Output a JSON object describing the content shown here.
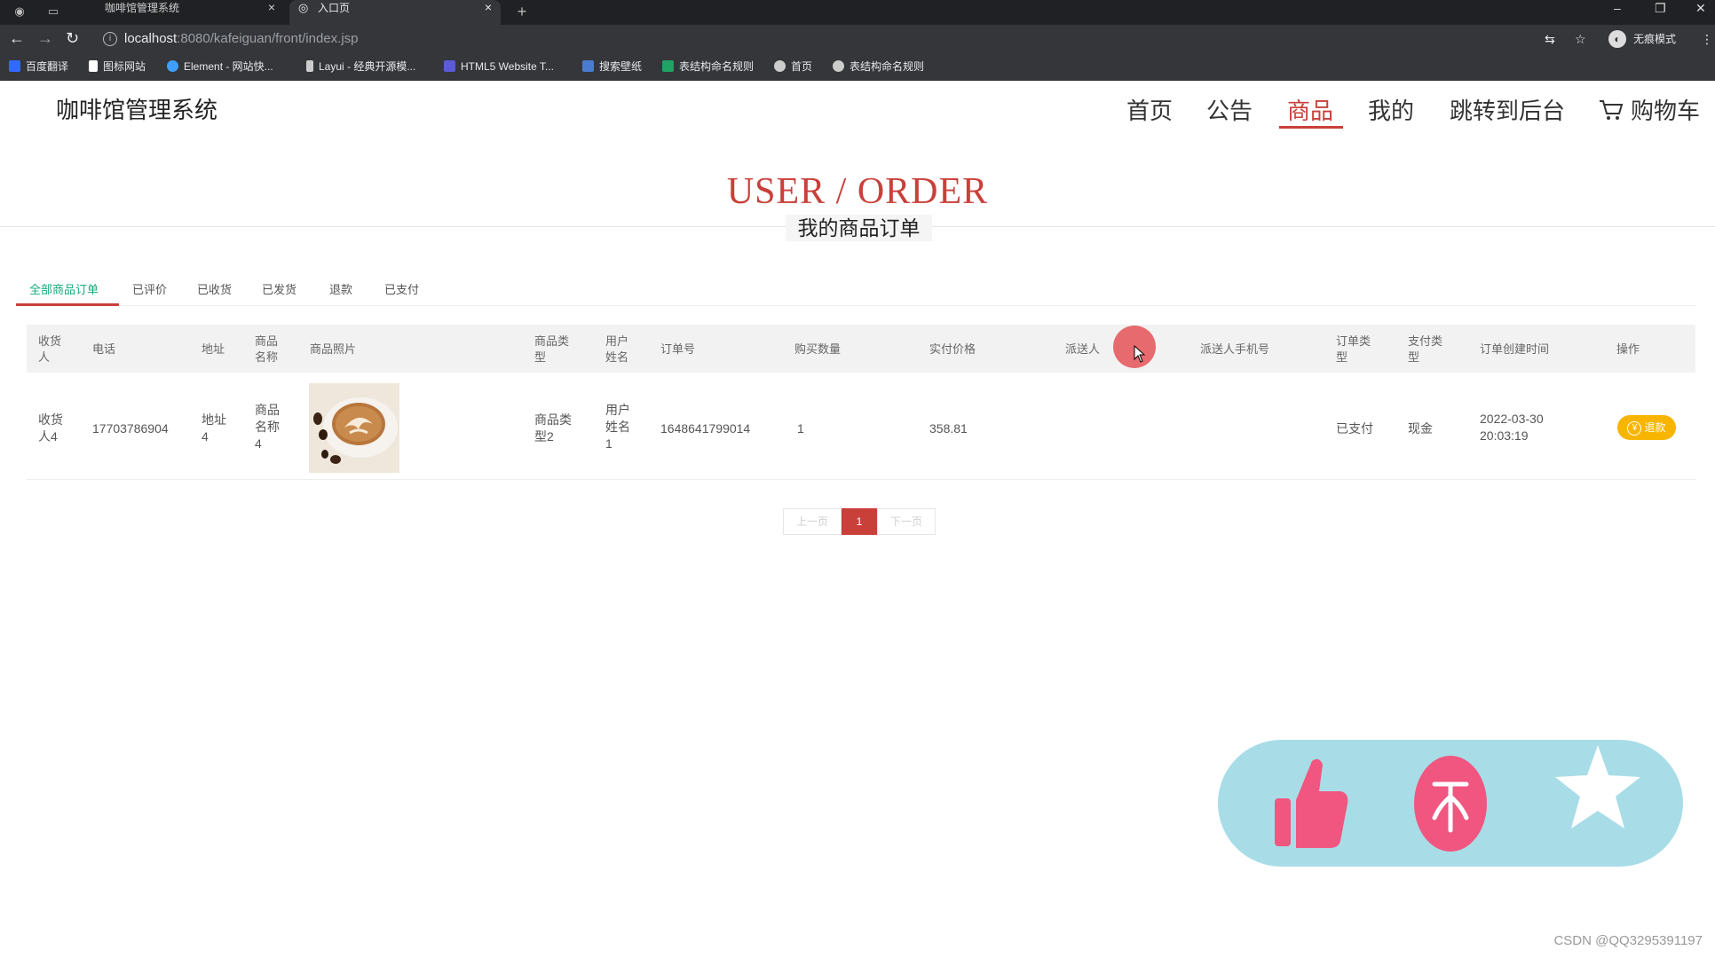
{
  "browser": {
    "tabs": [
      {
        "label": "咖啡馆管理系统",
        "close": "×"
      },
      {
        "label": "入口页",
        "close": "×"
      }
    ],
    "new_tab": "+",
    "url_host": "localhost",
    "url_path": ":8080/kafeiguan/front/index.jsp",
    "profile_label": "无痕模式",
    "window_controls": {
      "minimize": "–",
      "restore": "❐",
      "close": "✕"
    },
    "bookmarks": [
      {
        "label": "百度翻译",
        "color": "#2f6bff"
      },
      {
        "label": "图标网站",
        "color": "#ffffff"
      },
      {
        "label": "Element - 网站快...",
        "color": "#409eff"
      },
      {
        "label": "Layui - 经典开源模...",
        "color": "#cccccc"
      },
      {
        "label": "HTML5 Website T...",
        "color": "#5b5bd6"
      },
      {
        "label": "搜索壁纸",
        "color": "#4a7bd0"
      },
      {
        "label": "表结构命名规则",
        "color": "#21a366"
      },
      {
        "label": "首页",
        "color": "#cccccc"
      },
      {
        "label": "表结构命名规则",
        "color": "#cccccc"
      }
    ]
  },
  "site": {
    "title": "咖啡馆管理系统"
  },
  "nav": {
    "items": [
      "首页",
      "公告",
      "商品",
      "我的",
      "跳转到后台"
    ],
    "active": "商品",
    "cart_label": "购物车"
  },
  "page": {
    "title_en": "USER / ORDER",
    "title_cn": "我的商品订单"
  },
  "order_tabs": {
    "items": [
      "全部商品订单",
      "已评价",
      "已收货",
      "已发货",
      "退款",
      "已支付"
    ],
    "active": "全部商品订单"
  },
  "table": {
    "columns": [
      [
        "收货",
        "人"
      ],
      [
        "电话"
      ],
      [
        "地址"
      ],
      [
        "商品",
        "名称"
      ],
      [
        "商品照片"
      ],
      [
        "商品类",
        "型"
      ],
      [
        "用户",
        "姓名"
      ],
      [
        "订单号"
      ],
      [
        "购买数量"
      ],
      [
        "实付价格"
      ],
      [
        "派送人"
      ],
      [
        "派送人手机号"
      ],
      [
        "订单类",
        "型"
      ],
      [
        "支付类",
        "型"
      ],
      [
        "订单创建时间"
      ],
      [
        "操作"
      ]
    ],
    "rows": [
      {
        "receiver": [
          "收货",
          "人4"
        ],
        "phone": "17703786904",
        "address": [
          "地址",
          "4"
        ],
        "product_name": [
          "商品",
          "名称",
          "4"
        ],
        "product_type": [
          "商品类",
          "型2"
        ],
        "user_name": [
          "用户",
          "姓名",
          "1"
        ],
        "order_no": "1648641799014",
        "quantity": "1",
        "paid_price": "358.81",
        "courier": "",
        "courier_phone": "",
        "order_type": "已支付",
        "pay_type": "现金",
        "created": [
          "2022-03-30",
          "20:03:19"
        ],
        "action_label": "退款",
        "action_icon": "¥"
      }
    ]
  },
  "pagination": {
    "prev": "上一页",
    "current": "1",
    "next": "下一页"
  },
  "colors": {
    "accent": "#c9403a",
    "tab_active": "#19a97b",
    "refund_button": "#f7b500",
    "pill_bg": "#a8dde8",
    "pill_icons": "#f0567f"
  },
  "floating_actions": [
    "thumbs-up-icon",
    "top-icon",
    "star-icon"
  ],
  "watermark": "CSDN @QQ3295391197"
}
